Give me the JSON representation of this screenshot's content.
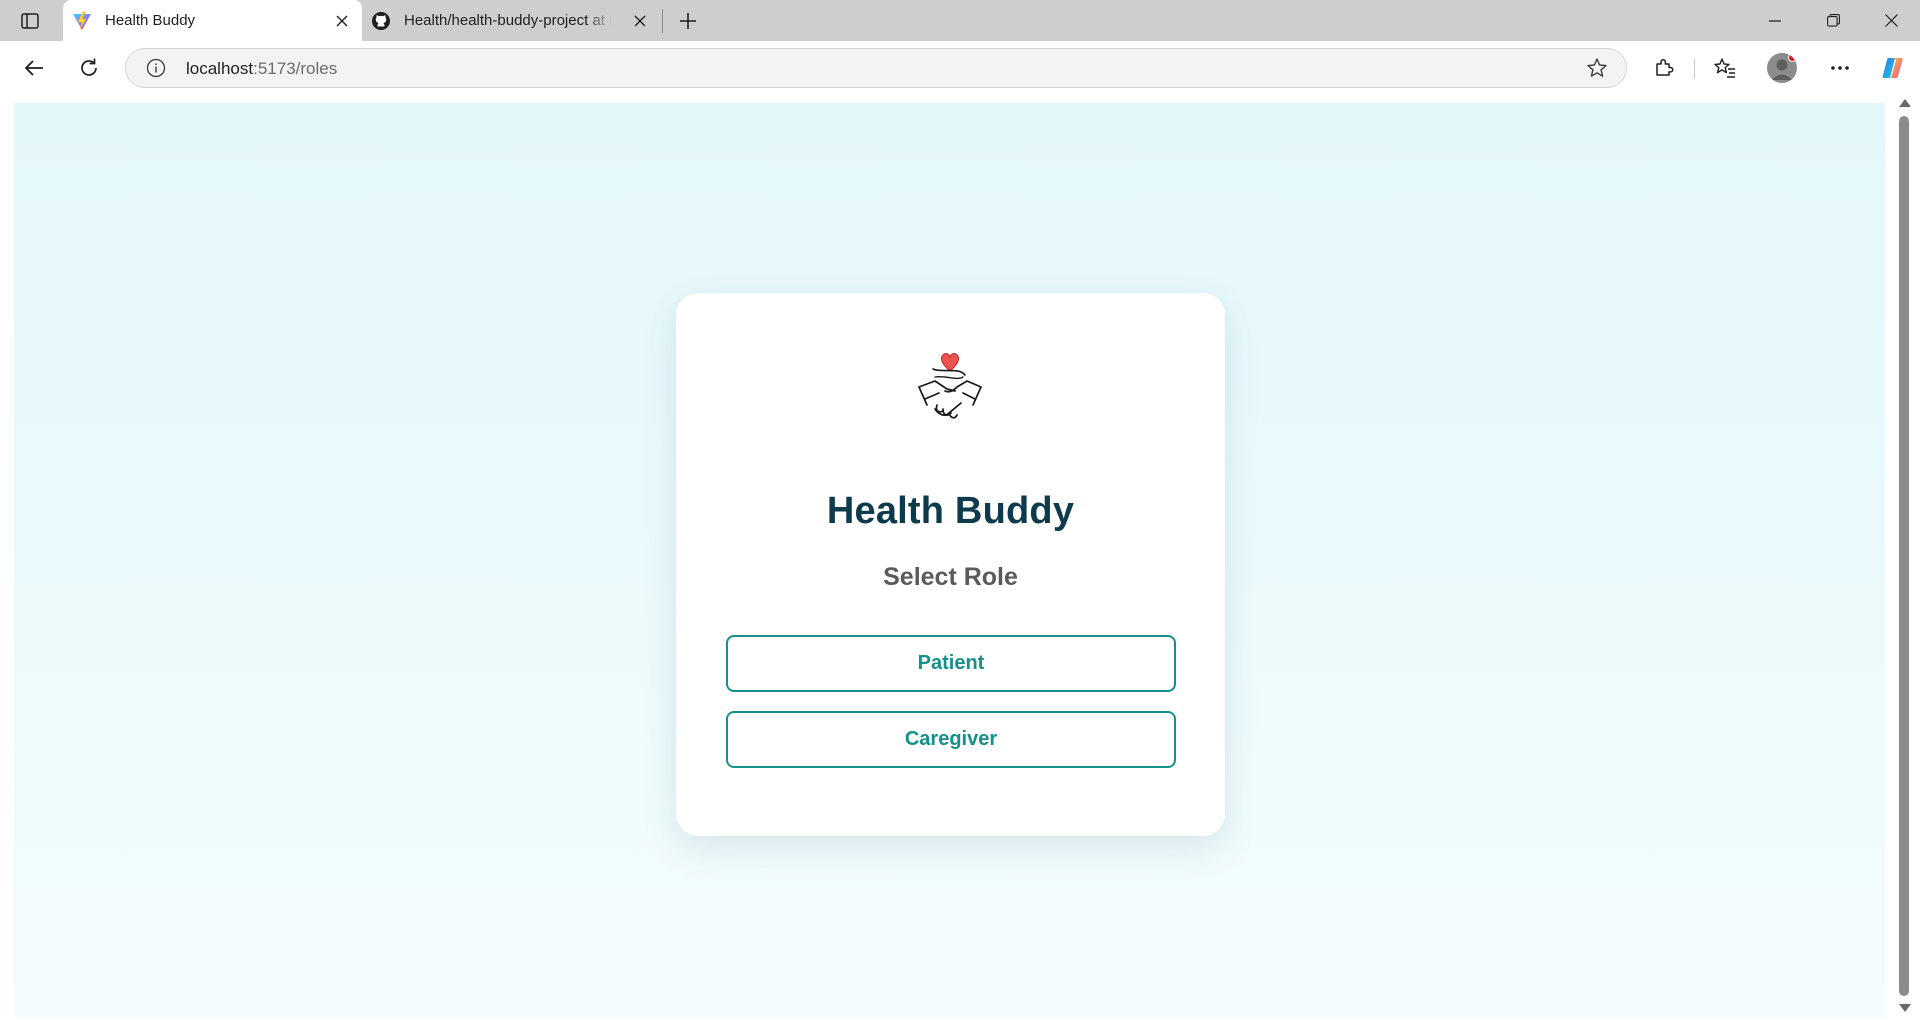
{
  "browser": {
    "tabs": [
      {
        "title": "Health Buddy",
        "favicon": "vite-logo-icon",
        "active": true
      },
      {
        "title": "Health/health-buddy-project at main",
        "favicon": "github-icon",
        "active": false
      }
    ],
    "address_bar": {
      "host": "localhost",
      "path": ":5173/roles"
    }
  },
  "app": {
    "logo": "handshake-heart-icon",
    "title": "Health Buddy",
    "subtitle": "Select Role",
    "roles": [
      {
        "label": "Patient"
      },
      {
        "label": "Caregiver"
      }
    ],
    "colors": {
      "accent": "#15908a",
      "title": "#0d3a4c",
      "subtitle": "#5a5a5a",
      "background": "#e4f7fa"
    }
  }
}
